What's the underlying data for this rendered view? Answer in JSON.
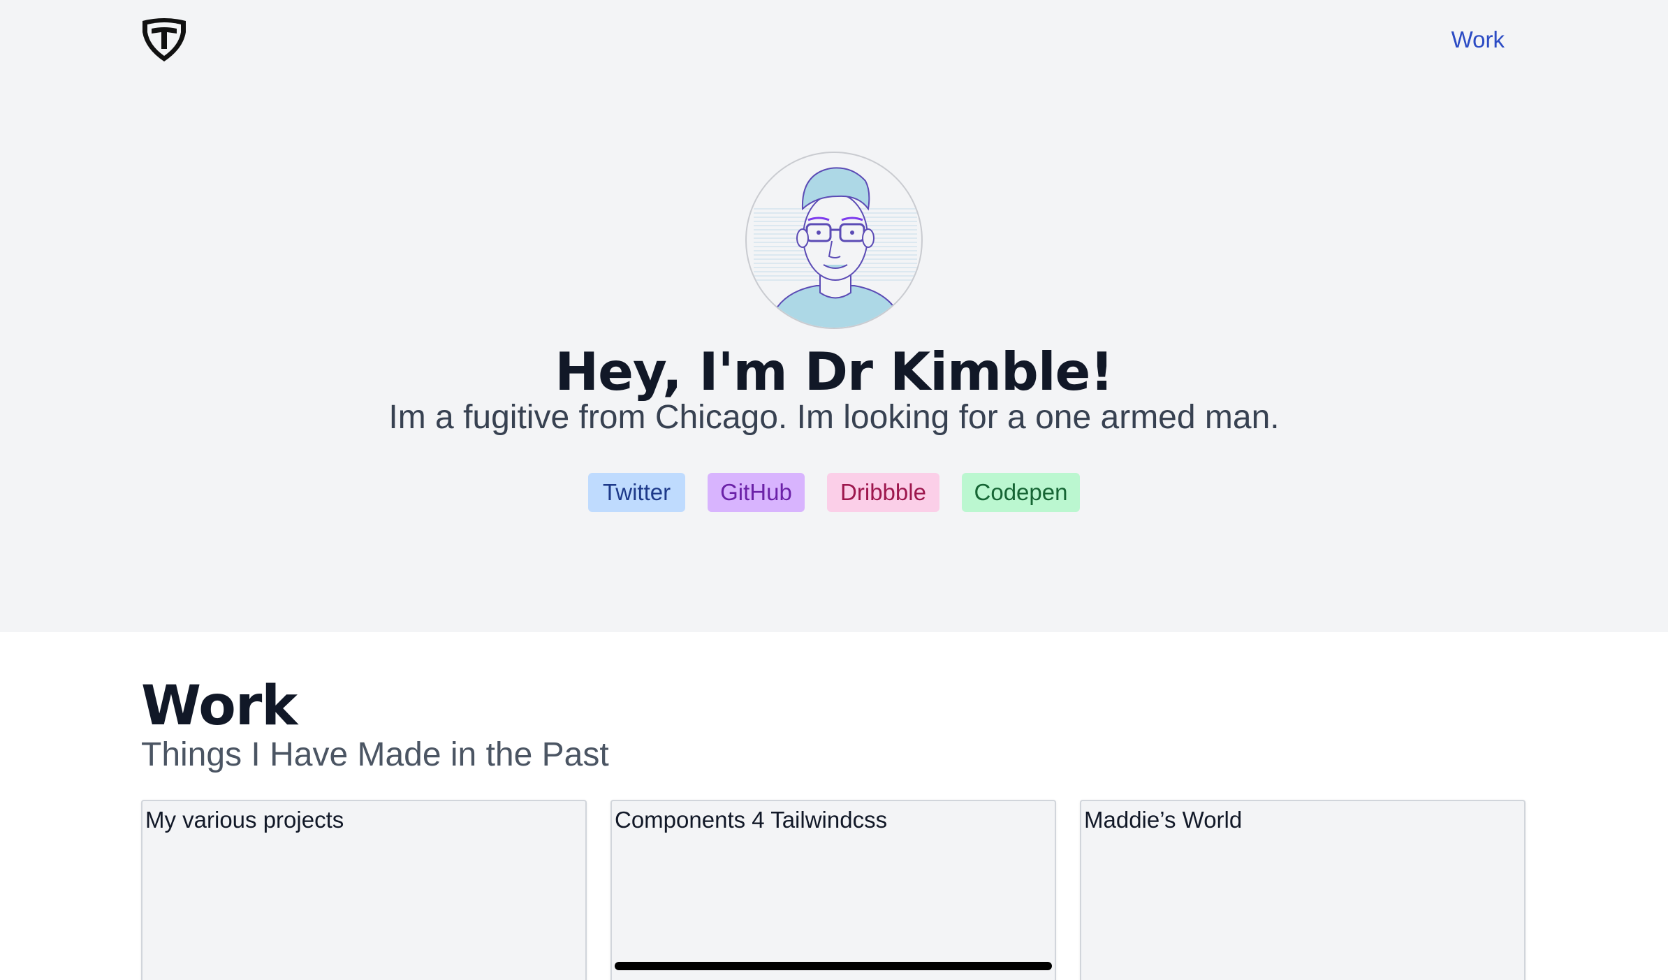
{
  "nav": {
    "logo_icon": "shield-t-logo-icon",
    "work_link": "Work"
  },
  "hero": {
    "avatar_icon": "cartoon-avatar-icon",
    "title": "Hey, I'm Dr Kimble!",
    "subtitle": "Im a fugitive from Chicago. Im looking for a one armed man.",
    "social": [
      {
        "label": "Twitter",
        "color": "#bfdbfe"
      },
      {
        "label": "GitHub",
        "color": "#d8b4fe"
      },
      {
        "label": "Dribbble",
        "color": "#fbcfe8"
      },
      {
        "label": "Codepen",
        "color": "#bbf7d0"
      }
    ]
  },
  "work": {
    "title": "Work",
    "subtitle": "Things I Have Made in the Past",
    "cards": [
      {
        "title": "My various projects"
      },
      {
        "title": "Components 4 Tailwindcss"
      },
      {
        "title": "Maddie’s World"
      }
    ]
  },
  "colors": {
    "hero_bg": "#f3f4f6",
    "link": "#2b4bc4",
    "heading": "#111827"
  }
}
